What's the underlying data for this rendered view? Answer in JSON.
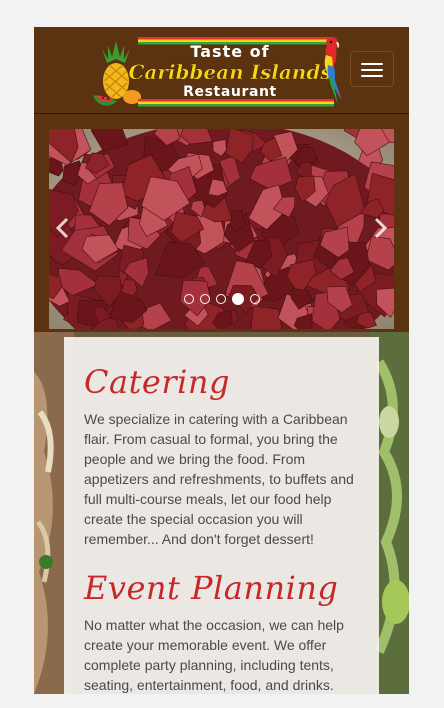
{
  "header": {
    "logo": {
      "line1": "Taste of",
      "line2": "Caribbean Islands",
      "line3": "Restaurant",
      "stripe_colors": [
        "#e8312b",
        "#f7d51d",
        "#3aa33a"
      ]
    },
    "menu_icon": "hamburger-icon",
    "accent_color": "#5b3310"
  },
  "carousel": {
    "prev_icon": "chevron-left-icon",
    "next_icon": "chevron-right-icon",
    "slide_count": 5,
    "active_index": 3
  },
  "sections": [
    {
      "heading": "Catering",
      "text": "We specialize in catering with a Caribbean flair. From casual to formal, you bring the people and we bring the food. From appetizers and refreshments, to buffets and full multi-course meals, let our food help create the special occasion you will remember... And don't forget dessert!"
    },
    {
      "heading": "Event Planning",
      "text": "No matter what the occasion, we can help create your memorable event. We offer complete party planning, including tents, seating, entertainment, food, and drinks."
    }
  ],
  "colors": {
    "heading_red": "#c8282b",
    "brown": "#5b3310"
  }
}
